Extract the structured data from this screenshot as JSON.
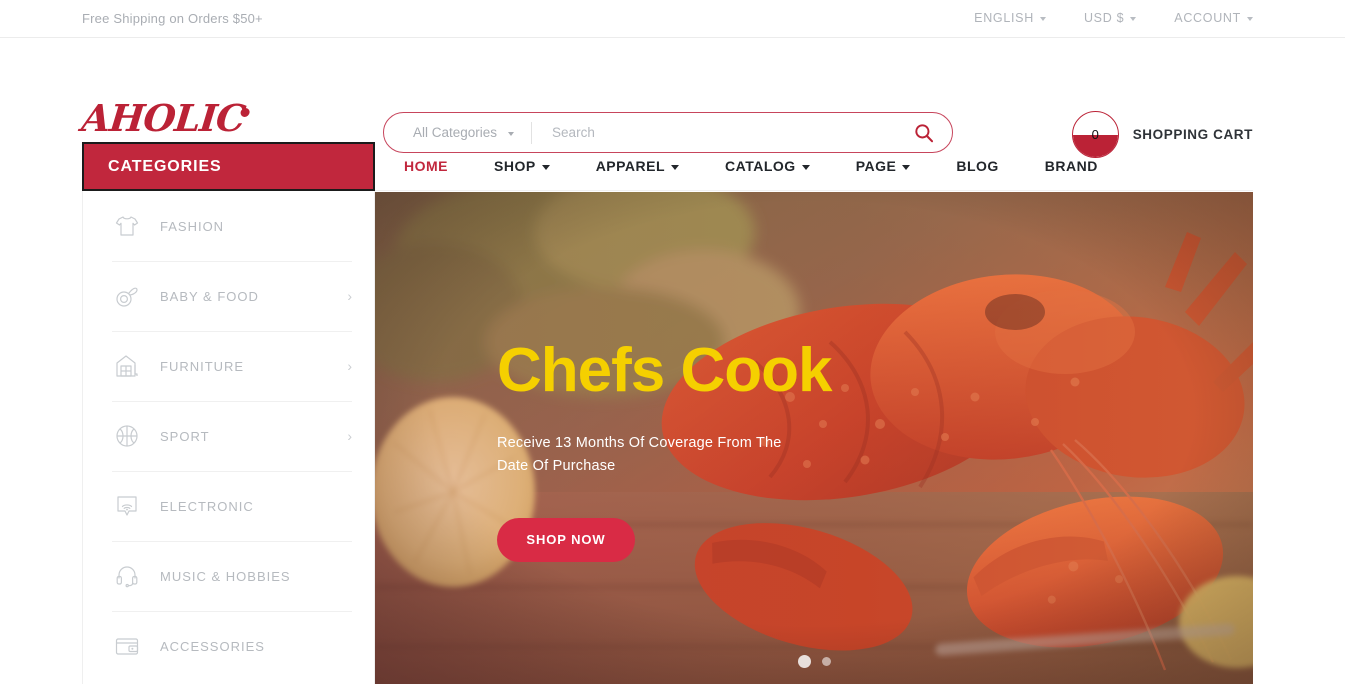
{
  "topbar": {
    "shipping_note": "Free Shipping on Orders $50+",
    "links": [
      {
        "label": "ENGLISH",
        "icon": "chevron-down-icon"
      },
      {
        "label": "USD $",
        "icon": "chevron-down-icon"
      },
      {
        "label": "ACCOUNT",
        "icon": "chevron-down-icon"
      }
    ]
  },
  "header": {
    "logo_text": "AHOLIC",
    "search": {
      "category_label": "All Categories",
      "placeholder": "Search",
      "value": "",
      "icon": "search-icon"
    },
    "cart": {
      "count": "0",
      "label": "SHOPPING CART",
      "icon": "cart-icon"
    }
  },
  "categories_panel": {
    "title": "CATEGORIES",
    "items": [
      {
        "label": "FASHION",
        "icon": "tshirt-icon",
        "has_submenu": false
      },
      {
        "label": "BABY & FOOD",
        "icon": "pacifier-icon",
        "has_submenu": true
      },
      {
        "label": "FURNITURE",
        "icon": "house-icon",
        "has_submenu": true
      },
      {
        "label": "SPORT",
        "icon": "basketball-icon",
        "has_submenu": true
      },
      {
        "label": "ELECTRONIC",
        "icon": "wifi-signal-icon",
        "has_submenu": false
      },
      {
        "label": "MUSIC & HOBBIES",
        "icon": "headset-icon",
        "has_submenu": false
      },
      {
        "label": "ACCESSORIES",
        "icon": "wallet-icon",
        "has_submenu": false
      }
    ],
    "submenu_icon": "chevron-right-icon"
  },
  "mainnav": {
    "items": [
      {
        "label": "HOME",
        "active": true,
        "has_dropdown": false
      },
      {
        "label": "SHOP",
        "active": false,
        "has_dropdown": true
      },
      {
        "label": "APPAREL",
        "active": false,
        "has_dropdown": true
      },
      {
        "label": "CATALOG",
        "active": false,
        "has_dropdown": true
      },
      {
        "label": "PAGE",
        "active": false,
        "has_dropdown": true
      },
      {
        "label": "BLOG",
        "active": false,
        "has_dropdown": false
      },
      {
        "label": "BRAND",
        "active": false,
        "has_dropdown": false
      }
    ]
  },
  "hero": {
    "title": "Chefs Cook",
    "subtitle": "Receive 13 Months Of Coverage From The Date Of Purchase",
    "cta_label": "SHOP NOW",
    "image_description": "cooked lobster on wooden board with lemon slice",
    "slides": [
      {
        "active": true
      },
      {
        "active": false
      }
    ]
  },
  "colors": {
    "brand_red": "#c1273d",
    "logo_red": "#bb2236",
    "cta_red": "#d92b45",
    "hero_title_yellow": "#f5d000",
    "muted_text": "#b6babf"
  }
}
